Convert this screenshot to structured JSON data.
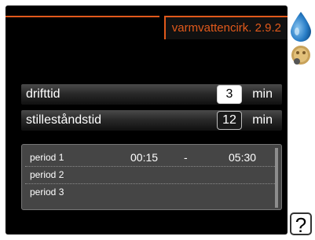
{
  "header": {
    "title": "varmvattencirk. 2.9.2"
  },
  "settings": [
    {
      "label": "drifttid",
      "value": "3",
      "unit": "min"
    },
    {
      "label": "stilleståndstid",
      "value": "12",
      "unit": "min"
    }
  ],
  "periods": [
    {
      "name": "period 1",
      "start": "00:15",
      "separator": "-",
      "end": "05:30"
    },
    {
      "name": "period 2",
      "start": "",
      "separator": "",
      "end": ""
    },
    {
      "name": "period 3",
      "start": "",
      "separator": "",
      "end": ""
    }
  ],
  "icons": {
    "drop": "water-drop-icon",
    "badge": "thermostat-badge-icon",
    "help": "help-icon",
    "help_symbol": "?"
  },
  "colors": {
    "accent": "#e1591b",
    "screen_bg": "#000000",
    "drop": "#1b6fb8"
  }
}
